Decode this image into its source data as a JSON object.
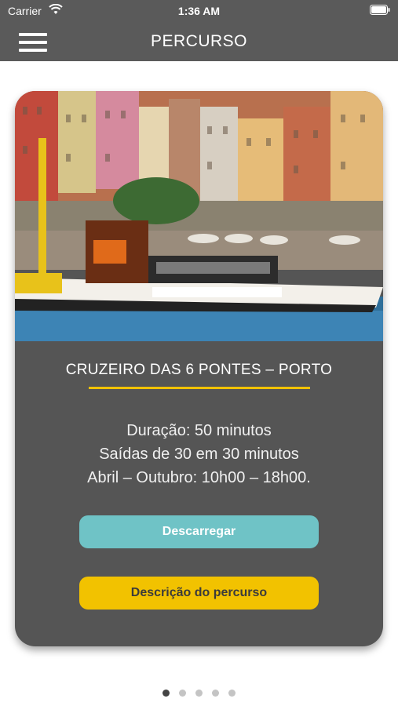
{
  "status_bar": {
    "carrier": "Carrier",
    "time": "1:36 AM"
  },
  "nav": {
    "title": "PERCURSO"
  },
  "card": {
    "image": "porto-cruz-boat-photo",
    "title": "CRUZEIRO DAS 6 PONTES – PORTO",
    "info": [
      "Duração: 50 minutos",
      "Saídas de 30 em 30 minutos",
      "Abril – Outubro: 10h00 – 18h00."
    ],
    "download_label": "Descarregar",
    "description_label": "Descrição do percurso"
  },
  "pager": {
    "pages": 5,
    "active_index": 0
  },
  "colors": {
    "bar": "#5a5a5a",
    "card": "#555555",
    "accent_yellow": "#f2c200",
    "accent_teal": "#6fc3c6"
  }
}
